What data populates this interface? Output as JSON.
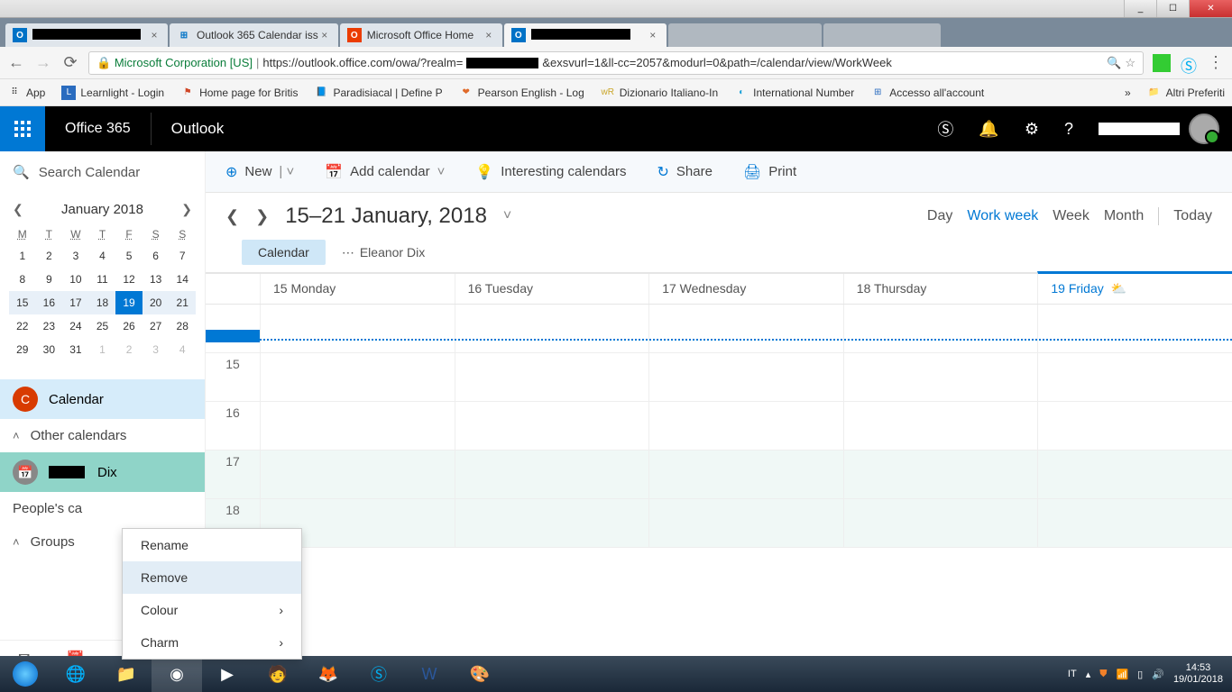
{
  "window": {
    "min": "_",
    "max": "☐",
    "close": "✕"
  },
  "tabs": [
    {
      "title": "[redacted]",
      "fav": "O",
      "favbg": "#0072c6"
    },
    {
      "title": "Outlook 365 Calendar iss",
      "fav": "⊞",
      "favbg": "#fff"
    },
    {
      "title": "Microsoft Office Home",
      "fav": "O",
      "favbg": "#eb3c00"
    },
    {
      "title": "[redacted]",
      "fav": "O",
      "favbg": "#0072c6",
      "active": true
    },
    {
      "title": "",
      "fav": "",
      "dim": true
    },
    {
      "title": "",
      "fav": "",
      "dim": true
    }
  ],
  "url": {
    "corp": "Microsoft Corporation [US]",
    "pre": "https://outlook.office.com/owa/?realm=",
    "post": "&exsvurl=1&ll-cc=2057&modurl=0&path=/calendar/view/WorkWeek"
  },
  "bookmarks": {
    "app": "App",
    "items": [
      {
        "t": "Learnlight - Login",
        "c": "#2a6cbf"
      },
      {
        "t": "Home page for Britis",
        "c": "#d04626"
      },
      {
        "t": "Paradisiacal | Define P",
        "c": "#2a6cbf"
      },
      {
        "t": "Pearson English - Log",
        "c": "#e06a2a"
      },
      {
        "t": "Dizionario Italiano-In",
        "c": "#caa62a"
      },
      {
        "t": "International Number",
        "c": "#1aa0d8"
      },
      {
        "t": "Accesso all'account",
        "c": "#2a6cbf"
      }
    ],
    "more": "»",
    "folder": "Altri Preferiti"
  },
  "header": {
    "suite": "Office 365",
    "app": "Outlook"
  },
  "search": {
    "placeholder": "Search Calendar"
  },
  "minical": {
    "title": "January 2018",
    "dh": [
      "M",
      "T",
      "W",
      "T",
      "F",
      "S",
      "S"
    ],
    "rows": [
      [
        "1",
        "2",
        "3",
        "4",
        "5",
        "6",
        "7"
      ],
      [
        "8",
        "9",
        "10",
        "11",
        "12",
        "13",
        "14"
      ],
      [
        "15",
        "16",
        "17",
        "18",
        "19",
        "20",
        "21"
      ],
      [
        "22",
        "23",
        "24",
        "25",
        "26",
        "27",
        "28"
      ],
      [
        "29",
        "30",
        "31",
        "1",
        "2",
        "3",
        "4"
      ]
    ]
  },
  "sidebar": {
    "calendar": "Calendar",
    "other": "Other calendars",
    "shared": "Dix",
    "people": "People's ca",
    "groups": "Groups"
  },
  "toolbar": {
    "new": "New",
    "addcal": "Add calendar",
    "interesting": "Interesting calendars",
    "share": "Share",
    "print": "Print"
  },
  "dateTitle": "15–21 January, 2018",
  "views": {
    "day": "Day",
    "work": "Work week",
    "week": "Week",
    "month": "Month",
    "today": "Today"
  },
  "chips": {
    "cal": "Calendar",
    "person": "Eleanor Dix"
  },
  "days": [
    {
      "t": "15 Monday"
    },
    {
      "t": "16 Tuesday"
    },
    {
      "t": "17 Wednesday"
    },
    {
      "t": "18 Thursday"
    },
    {
      "t": "19 Friday",
      "today": true
    }
  ],
  "hours": [
    "",
    "15",
    "16",
    "17",
    "18"
  ],
  "ctx": {
    "rename": "Rename",
    "remove": "Remove",
    "colour": "Colour",
    "charm": "Charm"
  },
  "tray": {
    "lang": "IT",
    "time": "14:53",
    "date": "19/01/2018"
  }
}
